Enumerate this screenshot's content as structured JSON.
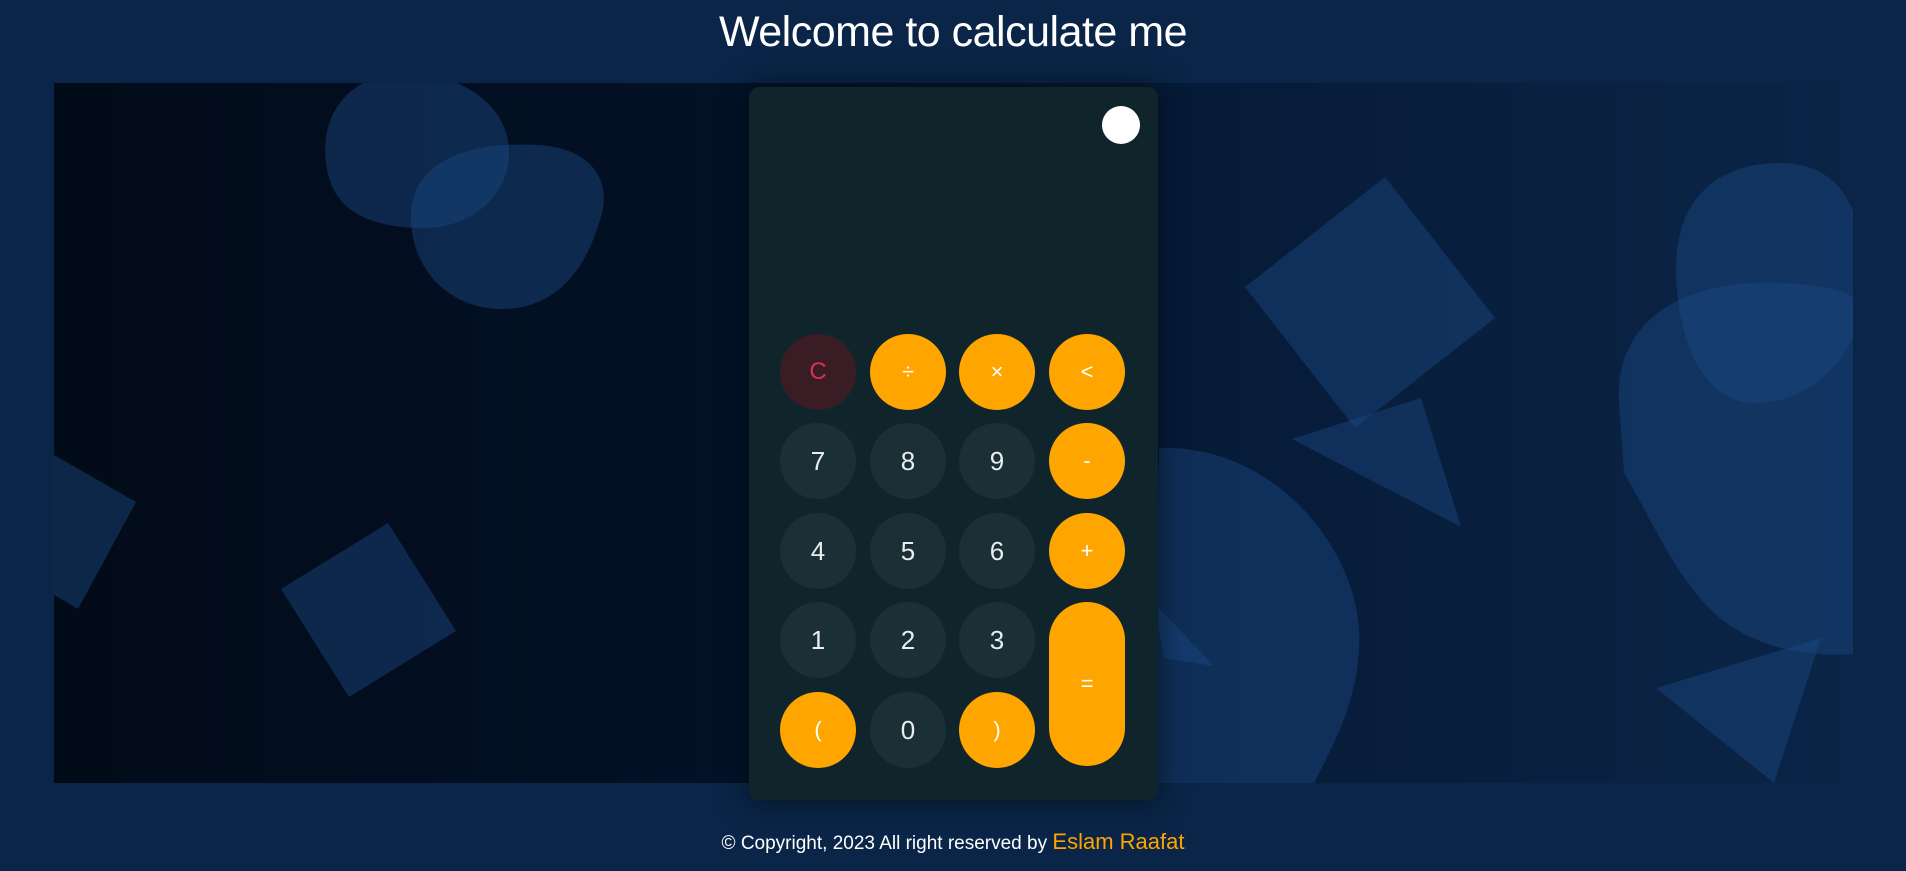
{
  "page": {
    "title": "Welcome to calculate me"
  },
  "calculator": {
    "display_value": "",
    "theme_toggle": "theme-toggle",
    "buttons": {
      "clear": "C",
      "divide": "÷",
      "multiply": "×",
      "backspace": "<",
      "seven": "7",
      "eight": "8",
      "nine": "9",
      "minus": "-",
      "four": "4",
      "five": "5",
      "six": "6",
      "plus": "+",
      "one": "1",
      "two": "2",
      "three": "3",
      "equals": "=",
      "open_paren": "(",
      "zero": "0",
      "close_paren": ")"
    }
  },
  "footer": {
    "copyright_text": "© Copyright, 2023 All right reserved by",
    "author": "Eslam Raafat"
  },
  "colors": {
    "background": "#0a2547",
    "calculator_body": "#10242b",
    "number_button": "#1b2f36",
    "operator_button": "#ffa500",
    "clear_button": "#3a1d24",
    "clear_text": "#d1344e",
    "accent": "#ffa500",
    "decor_shape": "#1a4a82"
  }
}
